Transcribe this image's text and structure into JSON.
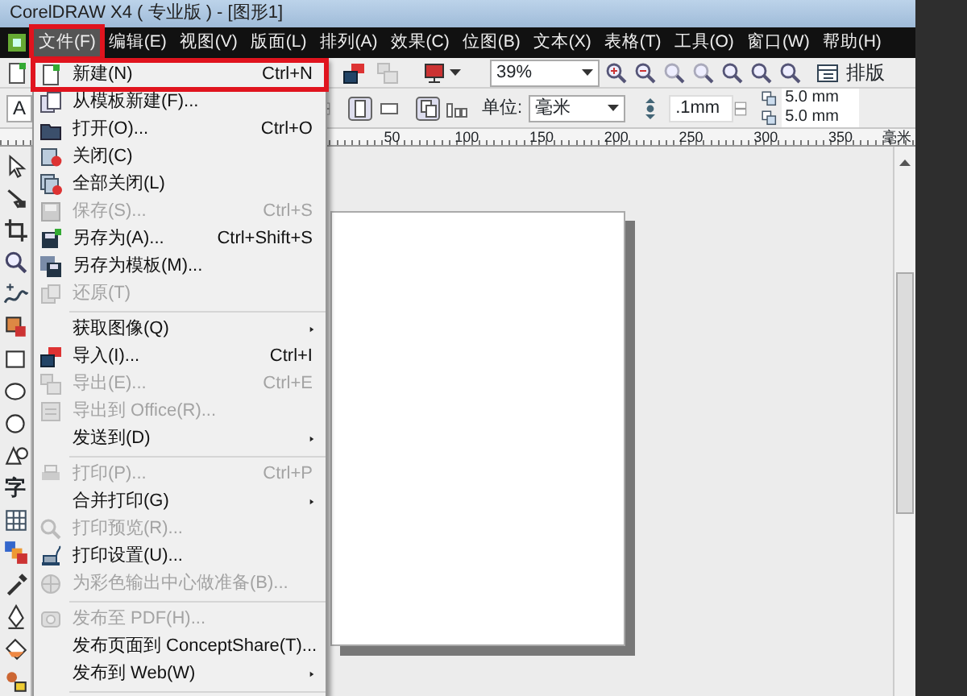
{
  "window": {
    "title": "CorelDRAW X4 ( 专业版 ) - [图形1]"
  },
  "menu_bar": [
    {
      "label": "文件(F)",
      "selected": true,
      "highlighted": true
    },
    {
      "label": "编辑(E)",
      "selected": false,
      "highlighted": false
    },
    {
      "label": "视图(V)",
      "selected": false,
      "highlighted": false
    },
    {
      "label": "版面(L)",
      "selected": false,
      "highlighted": false
    },
    {
      "label": "排列(A)",
      "selected": false,
      "highlighted": false
    },
    {
      "label": "效果(C)",
      "selected": false,
      "highlighted": false
    },
    {
      "label": "位图(B)",
      "selected": false,
      "highlighted": false
    },
    {
      "label": "文本(X)",
      "selected": false,
      "highlighted": false
    },
    {
      "label": "表格(T)",
      "selected": false,
      "highlighted": false
    },
    {
      "label": "工具(O)",
      "selected": false,
      "highlighted": false
    },
    {
      "label": "窗口(W)",
      "selected": false,
      "highlighted": false
    },
    {
      "label": "帮助(H)",
      "selected": false,
      "highlighted": false
    }
  ],
  "file_menu": {
    "items": [
      {
        "kind": "item",
        "label": "新建(N)",
        "shortcut": "Ctrl+N",
        "disabled": false,
        "submenu": false,
        "highlighted": true
      },
      {
        "kind": "item",
        "label": "从模板新建(F)...",
        "disabled": false,
        "submenu": false,
        "highlighted": false
      },
      {
        "kind": "item",
        "label": "打开(O)...",
        "shortcut": "Ctrl+O",
        "disabled": false,
        "submenu": false,
        "highlighted": false
      },
      {
        "kind": "item",
        "label": "关闭(C)",
        "disabled": false,
        "submenu": false,
        "highlighted": false
      },
      {
        "kind": "item",
        "label": "全部关闭(L)",
        "disabled": false,
        "submenu": false,
        "highlighted": false
      },
      {
        "kind": "item",
        "label": "保存(S)...",
        "shortcut": "Ctrl+S",
        "disabled": true,
        "submenu": false,
        "highlighted": false
      },
      {
        "kind": "item",
        "label": "另存为(A)...",
        "shortcut": "Ctrl+Shift+S",
        "disabled": false,
        "submenu": false,
        "highlighted": false
      },
      {
        "kind": "item",
        "label": "另存为模板(M)...",
        "disabled": false,
        "submenu": false,
        "highlighted": false
      },
      {
        "kind": "item",
        "label": "还原(T)",
        "disabled": true,
        "submenu": false,
        "highlighted": false
      },
      {
        "kind": "separator"
      },
      {
        "kind": "item",
        "label": "获取图像(Q)",
        "disabled": false,
        "submenu": true,
        "highlighted": false
      },
      {
        "kind": "item",
        "label": "导入(I)...",
        "shortcut": "Ctrl+I",
        "disabled": false,
        "submenu": false,
        "highlighted": false
      },
      {
        "kind": "item",
        "label": "导出(E)...",
        "shortcut": "Ctrl+E",
        "disabled": true,
        "submenu": false,
        "highlighted": false
      },
      {
        "kind": "item",
        "label": "导出到 Office(R)...",
        "disabled": true,
        "submenu": false,
        "highlighted": false
      },
      {
        "kind": "item",
        "label": "发送到(D)",
        "disabled": false,
        "submenu": true,
        "highlighted": false
      },
      {
        "kind": "separator"
      },
      {
        "kind": "item",
        "label": "打印(P)...",
        "shortcut": "Ctrl+P",
        "disabled": true,
        "submenu": false,
        "highlighted": false
      },
      {
        "kind": "item",
        "label": "合并打印(G)",
        "disabled": false,
        "submenu": true,
        "highlighted": false
      },
      {
        "kind": "item",
        "label": "打印预览(R)...",
        "disabled": true,
        "submenu": false,
        "highlighted": false
      },
      {
        "kind": "item",
        "label": "打印设置(U)...",
        "disabled": false,
        "submenu": false,
        "highlighted": false
      },
      {
        "kind": "item",
        "label": "为彩色输出中心做准备(B)...",
        "disabled": true,
        "submenu": false,
        "highlighted": false
      },
      {
        "kind": "separator"
      },
      {
        "kind": "item",
        "label": "发布至 PDF(H)...",
        "disabled": true,
        "submenu": false,
        "highlighted": false
      },
      {
        "kind": "item",
        "label": "发布页面到 ConceptShare(T)...",
        "disabled": false,
        "submenu": false,
        "highlighted": false
      },
      {
        "kind": "item",
        "label": "发布到 Web(W)",
        "disabled": false,
        "submenu": true,
        "highlighted": false
      },
      {
        "kind": "separator"
      }
    ]
  },
  "standard_toolbar": {
    "zoom_level": "39%",
    "layout_button": "排版"
  },
  "property_bar": {
    "style_button": "A",
    "units_label": "单位:",
    "units": "毫米",
    "nudge": ".1mm",
    "duplicate_x": "5.0 mm",
    "duplicate_y": "5.0 mm"
  },
  "ruler": {
    "ticks": [
      "50",
      "100",
      "150",
      "200",
      "250",
      "300",
      "350"
    ],
    "unit": "毫米"
  },
  "toolbox": {
    "text_tool": "字"
  }
}
